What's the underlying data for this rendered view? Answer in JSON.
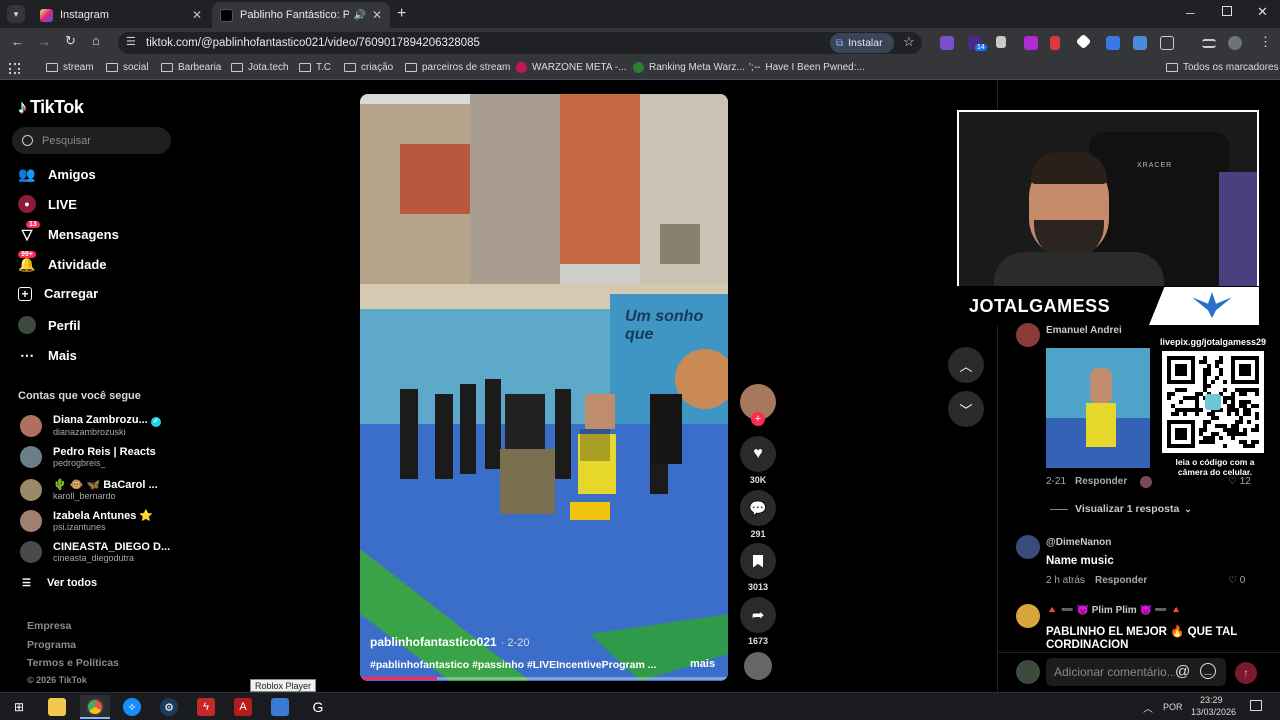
{
  "browser": {
    "tabs": [
      {
        "title": "Instagram"
      },
      {
        "title": "Pablinho Fantástico: Passinh"
      }
    ],
    "new_tab": "+",
    "url": "tiktok.com/@pablinhofantastico021/video/7609017894206328085",
    "install_label": "Instalar",
    "extension_badge": "14",
    "bookmarks": [
      "stream",
      "social",
      "Barbearia",
      "Jota.tech",
      "T.C",
      "criação",
      "parceiros de stream",
      "WARZONE META -...",
      "Ranking Meta Warz...",
      "Have I Been Pwned:..."
    ],
    "all_bookmarks": "Todos os marcadores"
  },
  "sidebar": {
    "logo": "TikTok",
    "search_placeholder": "Pesquisar",
    "nav": [
      {
        "label": "Amigos",
        "icon": "friends-icon"
      },
      {
        "label": "LIVE",
        "icon": "live-icon"
      },
      {
        "label": "Mensagens",
        "icon": "messages-icon",
        "badge": "13"
      },
      {
        "label": "Atividade",
        "icon": "activity-icon",
        "badge": "99+"
      },
      {
        "label": "Carregar",
        "icon": "upload-icon"
      },
      {
        "label": "Perfil",
        "icon": "profile-icon"
      },
      {
        "label": "Mais",
        "icon": "more-icon"
      }
    ],
    "following_title": "Contas que você segue",
    "following": [
      {
        "name": "Diana Zambrozu...",
        "handle": "dianazambrozuski"
      },
      {
        "name": "Pedro Reis | Reacts",
        "handle": "pedrogbreis_"
      },
      {
        "name": "🌵 🐵 🦋 BaCarol ...",
        "handle": "karoll_bernardo"
      },
      {
        "name": "Izabela Antunes ⭐",
        "handle": "psi.izantunes"
      },
      {
        "name": "CINEASTA_DIEGO D...",
        "handle": "cineasta_diegodutra"
      }
    ],
    "see_all": "Ver todos",
    "footer": [
      "Empresa",
      "Programa",
      "Termos e Políticas"
    ],
    "copyright": "© 2026 TikTok",
    "tooltip": "Roblox Player"
  },
  "video": {
    "author": "pablinhofantastico021",
    "date": "· 2-20",
    "caption": "#pablinhofantastico #passinho #LIVEIncentiveProgram ...",
    "more": "mais",
    "progress": 0.21,
    "mural_text": "Um sonho que"
  },
  "actions": {
    "likes": "30K",
    "comments": "291",
    "saves": "3013",
    "shares": "1673"
  },
  "overlay": {
    "channel": "JOTALGAMESS",
    "commenter": "Emanuel Andrei",
    "livepix": "livepix.gg/jotalgamess29",
    "qr_caption": "leia o código com a câmera do celular.",
    "chair_brand": "XRACER"
  },
  "comments": [
    {
      "meta": "2-21",
      "reply": "Responder",
      "likes": "12"
    },
    {
      "view_replies": "Visualizar 1 resposta"
    },
    {
      "user": "@DimeNanon",
      "text": "Name music",
      "time": "2 h atrás",
      "reply": "Responder",
      "likes": "0"
    },
    {
      "user": "🔺 ➖ 😈 Plim Plim 😈 ➖ 🔺",
      "text": "PABLINHO EL MEJOR 🔥 QUE TAL",
      "text2": "CORDINACION"
    }
  ],
  "comment_input": {
    "placeholder": "Adicionar comentário..."
  },
  "taskbar": {
    "lang": "POR",
    "time": "23:29",
    "date": "13/03/2026"
  },
  "colors": {
    "tiktok_red": "#fe2c55",
    "accent_blue": "#8ab4f8"
  }
}
